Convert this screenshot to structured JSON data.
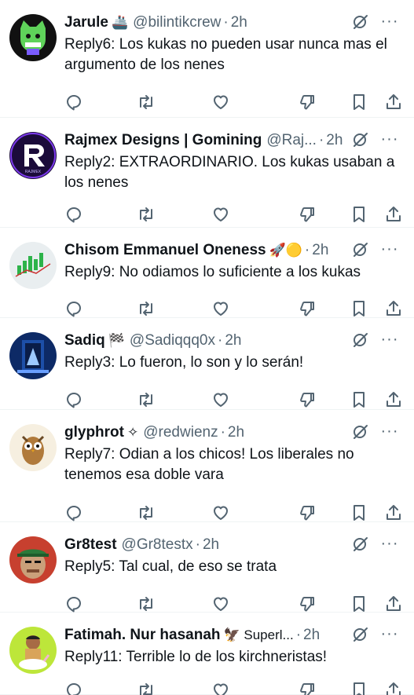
{
  "posts": [
    {
      "name": "Jarule",
      "emoji": "🚢",
      "handle": "@bilintikcrew",
      "dot": "·",
      "time": "2h",
      "text": "Reply6: Los kukas no pueden usar nunca mas el argumento de los nenes",
      "avatar_icon": "green-cat-avatar"
    },
    {
      "name": "Rajmex Designs | Gomining",
      "emoji": "",
      "handle": "@Raj...",
      "dot": "·",
      "time": "2h",
      "text": "Reply2: EXTRAORDINARIO. Los kukas usaban a los nenes",
      "avatar_icon": "r-logo-avatar"
    },
    {
      "name": "Chisom Emmanuel Oneness",
      "emoji": "🚀🟡",
      "handle": "",
      "dot": "·",
      "time": "2h",
      "text": "Reply9: No odiamos lo suficiente a los kukas",
      "avatar_icon": "chart-avatar"
    },
    {
      "name": "Sadiq",
      "emoji": "🏁",
      "handle": "@Sadiqqq0x",
      "dot": "·",
      "time": "2h",
      "text": "Reply3: Lo fueron, lo son y lo serán!",
      "avatar_icon": "portal-avatar"
    },
    {
      "name": "glyphrot",
      "emoji": "✧",
      "handle": "@redwienz",
      "dot": "·",
      "time": "2h",
      "text": "Reply7: Odian a los chicos! Los liberales no tenemos esa doble vara",
      "avatar_icon": "owl-avatar"
    },
    {
      "name": "Gr8test",
      "emoji": "",
      "handle": "@Gr8testx",
      "dot": "·",
      "time": "2h",
      "text": "Reply5: Tal cual, de eso se trata",
      "avatar_icon": "cap-man-avatar"
    },
    {
      "name": "Fatimah. Nur hasanah",
      "emoji": "🦅 Superl...",
      "handle": "",
      "dot": "·",
      "time": "2h",
      "text": "Reply11: Terrible lo de los kirchneristas!",
      "avatar_icon": "unicorn-rider-avatar"
    }
  ],
  "icons": {
    "more": "more-icon",
    "grok": "grok-icon",
    "reply": "reply-icon",
    "repost": "repost-icon",
    "like": "like-icon",
    "dislike": "dislike-icon",
    "bookmark": "bookmark-icon",
    "share": "share-icon"
  },
  "colors": {
    "text": "#0f1419",
    "secondary": "#536471",
    "divider": "#eff3f4"
  }
}
